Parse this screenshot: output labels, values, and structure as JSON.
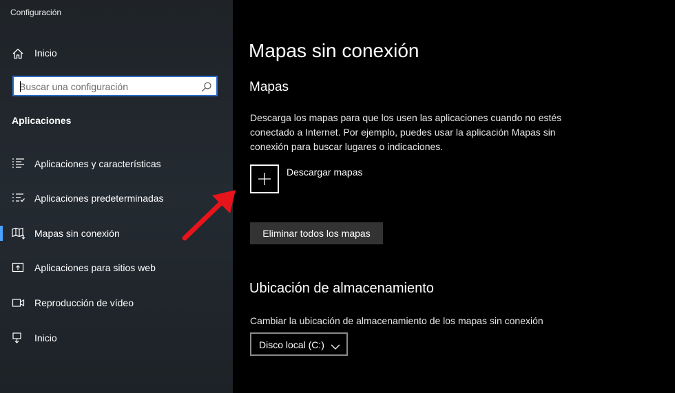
{
  "window": {
    "title": "Configuración"
  },
  "sidebar": {
    "home_label": "Inicio",
    "search_placeholder": "Buscar una configuración",
    "section_label": "Aplicaciones",
    "items": [
      {
        "label": "Aplicaciones y características",
        "icon": "apps-features-icon"
      },
      {
        "label": "Aplicaciones predeterminadas",
        "icon": "default-apps-icon"
      },
      {
        "label": "Mapas sin conexión",
        "icon": "offline-maps-icon",
        "active": true
      },
      {
        "label": "Aplicaciones para sitios web",
        "icon": "apps-websites-icon"
      },
      {
        "label": "Reproducción de vídeo",
        "icon": "video-playback-icon"
      },
      {
        "label": "Inicio",
        "icon": "startup-icon"
      }
    ]
  },
  "main": {
    "title": "Mapas sin conexión",
    "maps_heading": "Mapas",
    "maps_description": "Descarga los mapas para que los usen las aplicaciones cuando no estés conectado a Internet. Por ejemplo, puedes usar la aplicación Mapas sin conexión para buscar lugares o indicaciones.",
    "download_label": "Descargar mapas",
    "remove_all_label": "Eliminar todos los mapas",
    "storage_heading": "Ubicación de almacenamiento",
    "storage_description": "Cambiar la ubicación de almacenamiento de los mapas sin conexión",
    "storage_selected": "Disco local (C:)"
  },
  "colors": {
    "accent": "#4aa3ff",
    "search_border": "#2b6cc4",
    "annotation_arrow": "#e8141c",
    "main_background": "#000000",
    "sidebar_background": "#21262c"
  }
}
